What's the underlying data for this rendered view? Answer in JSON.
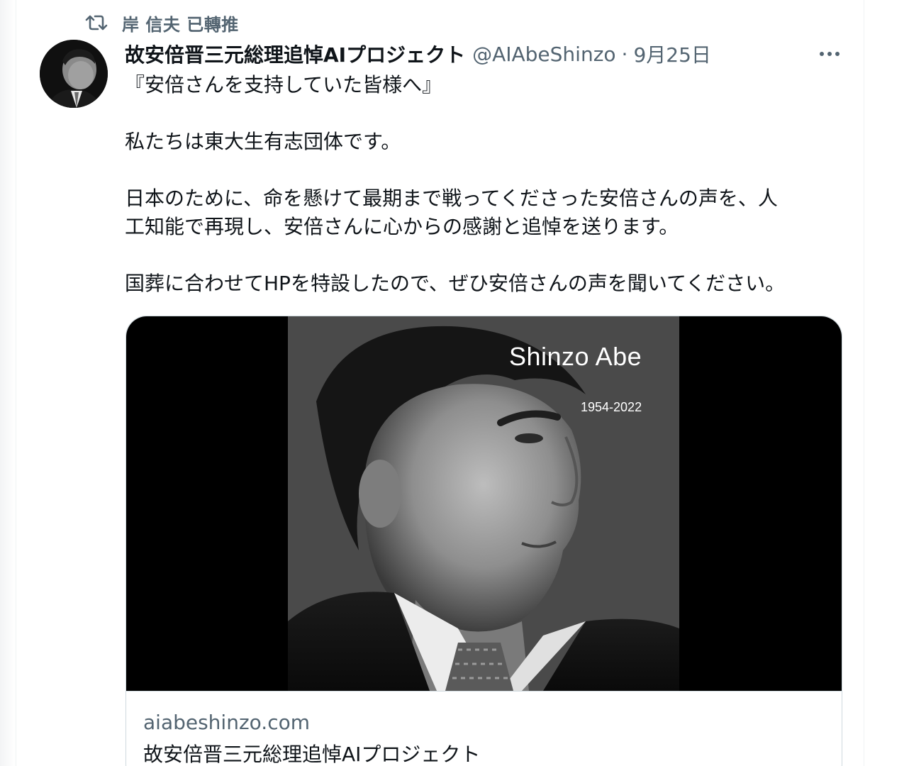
{
  "retweet": {
    "text": "岸 信夫 已轉推",
    "icon": "retweet-icon"
  },
  "tweet": {
    "display_name": "故安倍晋三元総理追悼AIプロジェクト",
    "handle": "@AIAbeShinzo",
    "separator": "·",
    "date": "9月25日",
    "more_icon": "more-horizontal-icon",
    "body": {
      "line1": "『安倍さんを支持していた皆様へ』",
      "line2": "私たちは東大生有志団体です。",
      "line3": "日本のために、命を懸けて最期まで戦ってくださった安倍さんの声を、人",
      "line4": "工知能で再現し、安倍さんに心からの感謝と追悼を送ります。",
      "line5": "国葬に合わせてHPを特設したので、ぜひ安倍さんの声を聞いてください。"
    }
  },
  "card": {
    "image_title": "Shinzo Abe",
    "image_years": "1954-2022",
    "domain": "aiabeshinzo.com",
    "title": "故安倍晋三元総理追悼AIプロジェクト"
  },
  "colors": {
    "text_primary": "#0f1419",
    "text_secondary": "#536471",
    "border": "#cfd9de"
  }
}
